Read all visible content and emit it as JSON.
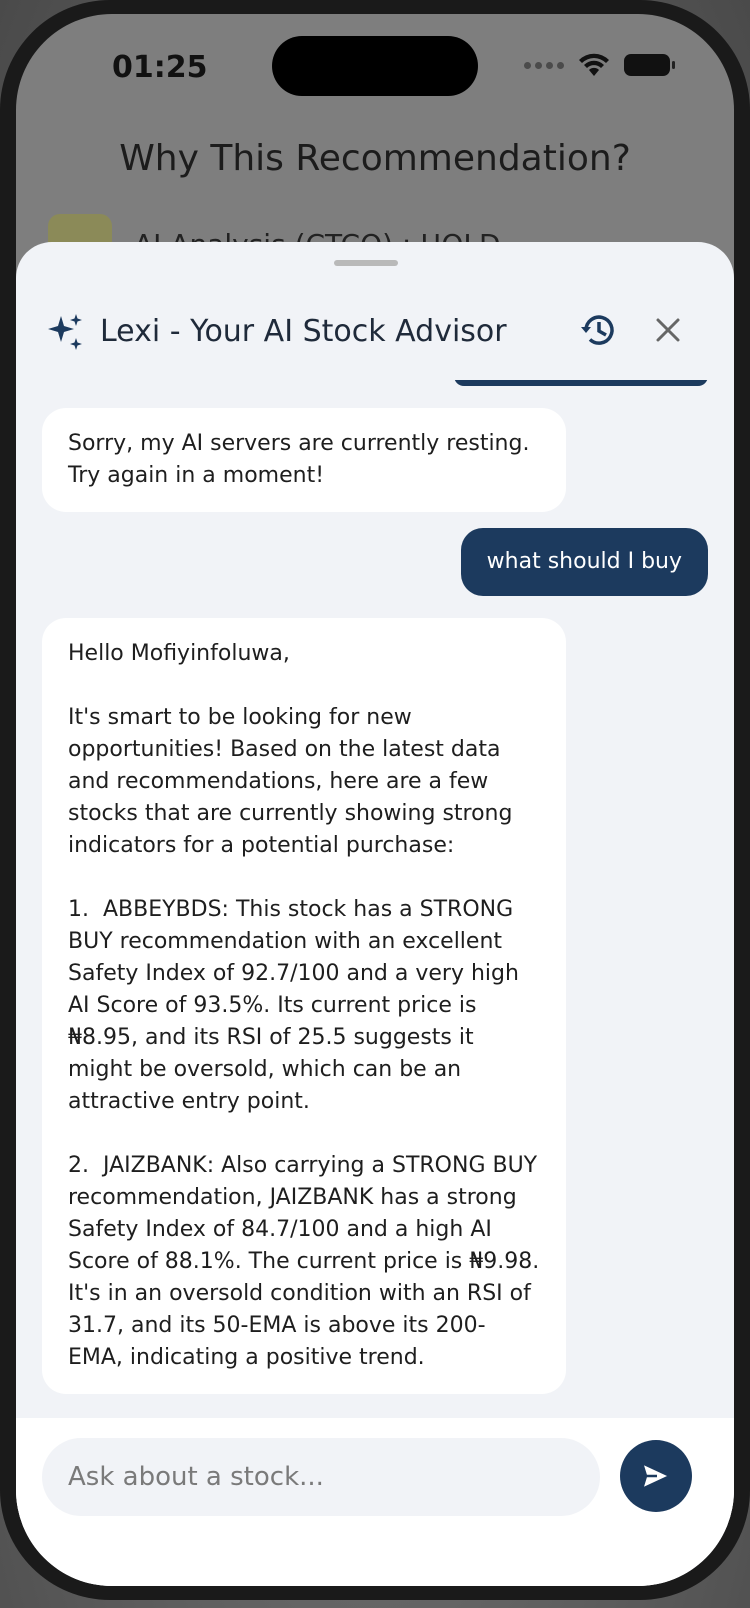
{
  "status_bar": {
    "time": "01:25"
  },
  "background_screen": {
    "title": "Why This Recommendation?",
    "subtitle": "AI Analysis (CTCO) : HOLD"
  },
  "sheet": {
    "title": "Lexi - Your AI Stock Advisor",
    "icons": {
      "title": "sparkle-icon",
      "history": "history-icon",
      "close": "close-icon"
    }
  },
  "messages": [
    {
      "role": "assistant",
      "text": "Sorry, my AI servers are currently resting. Try again in a moment!"
    },
    {
      "role": "user",
      "text": "what should I buy"
    },
    {
      "role": "assistant",
      "text": "Hello Mofiyinfoluwa,\n\nIt's smart to be looking for new opportunities! Based on the latest data and recommendations, here are a few stocks that are currently showing strong indicators for a potential purchase:\n\n1.  ABBEYBDS: This stock has a STRONG BUY recommendation with an excellent Safety Index of 92.7/100 and a very high AI Score of 93.5%. Its current price is ₦8.95, and its RSI of 25.5 suggests it might be oversold, which can be an attractive entry point.\n\n2.  JAIZBANK: Also carrying a STRONG BUY recommendation, JAIZBANK has a strong Safety Index of 84.7/100 and a high AI Score of 88.1%. The current price is ₦9.98. It's in an oversold condition with an RSI of 31.7, and its 50-EMA is above its 200-EMA, indicating a positive trend."
    }
  ],
  "composer": {
    "placeholder": "Ask about a stock...",
    "send_icon": "send-icon"
  },
  "colors": {
    "accent": "#1c3a5e",
    "sheet_bg": "#f1f3f7",
    "bubble_ai": "#ffffff"
  }
}
